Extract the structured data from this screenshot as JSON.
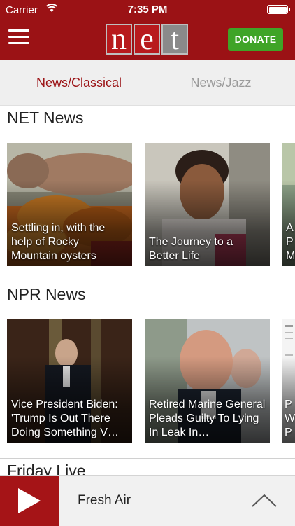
{
  "status": {
    "carrier": "Carrier",
    "time": "7:35 PM"
  },
  "header": {
    "logo_letters": [
      "n",
      "e",
      "t"
    ],
    "donate_label": "DONATE"
  },
  "tabs": [
    {
      "label": "News/Classical",
      "active": true
    },
    {
      "label": "News/Jazz",
      "active": false
    }
  ],
  "sections": [
    {
      "title": "NET News",
      "cards": [
        {
          "caption": "Settling in, with the help of Rocky Mountain oysters"
        },
        {
          "caption": "The Journey to a Better Life"
        },
        {
          "caption": "A P M"
        }
      ]
    },
    {
      "title": "NPR News",
      "cards": [
        {
          "caption": "Vice President Biden: 'Trump Is Out There Doing Something V…"
        },
        {
          "caption": "Retired Marine General Pleads Guilty To Lying In Leak In…"
        },
        {
          "caption": "P W P"
        }
      ]
    },
    {
      "title": "Friday Live"
    }
  ],
  "player": {
    "now_playing": "Fresh Air"
  },
  "colors": {
    "brand_red": "#9b1215",
    "donate_green": "#3fa427"
  }
}
